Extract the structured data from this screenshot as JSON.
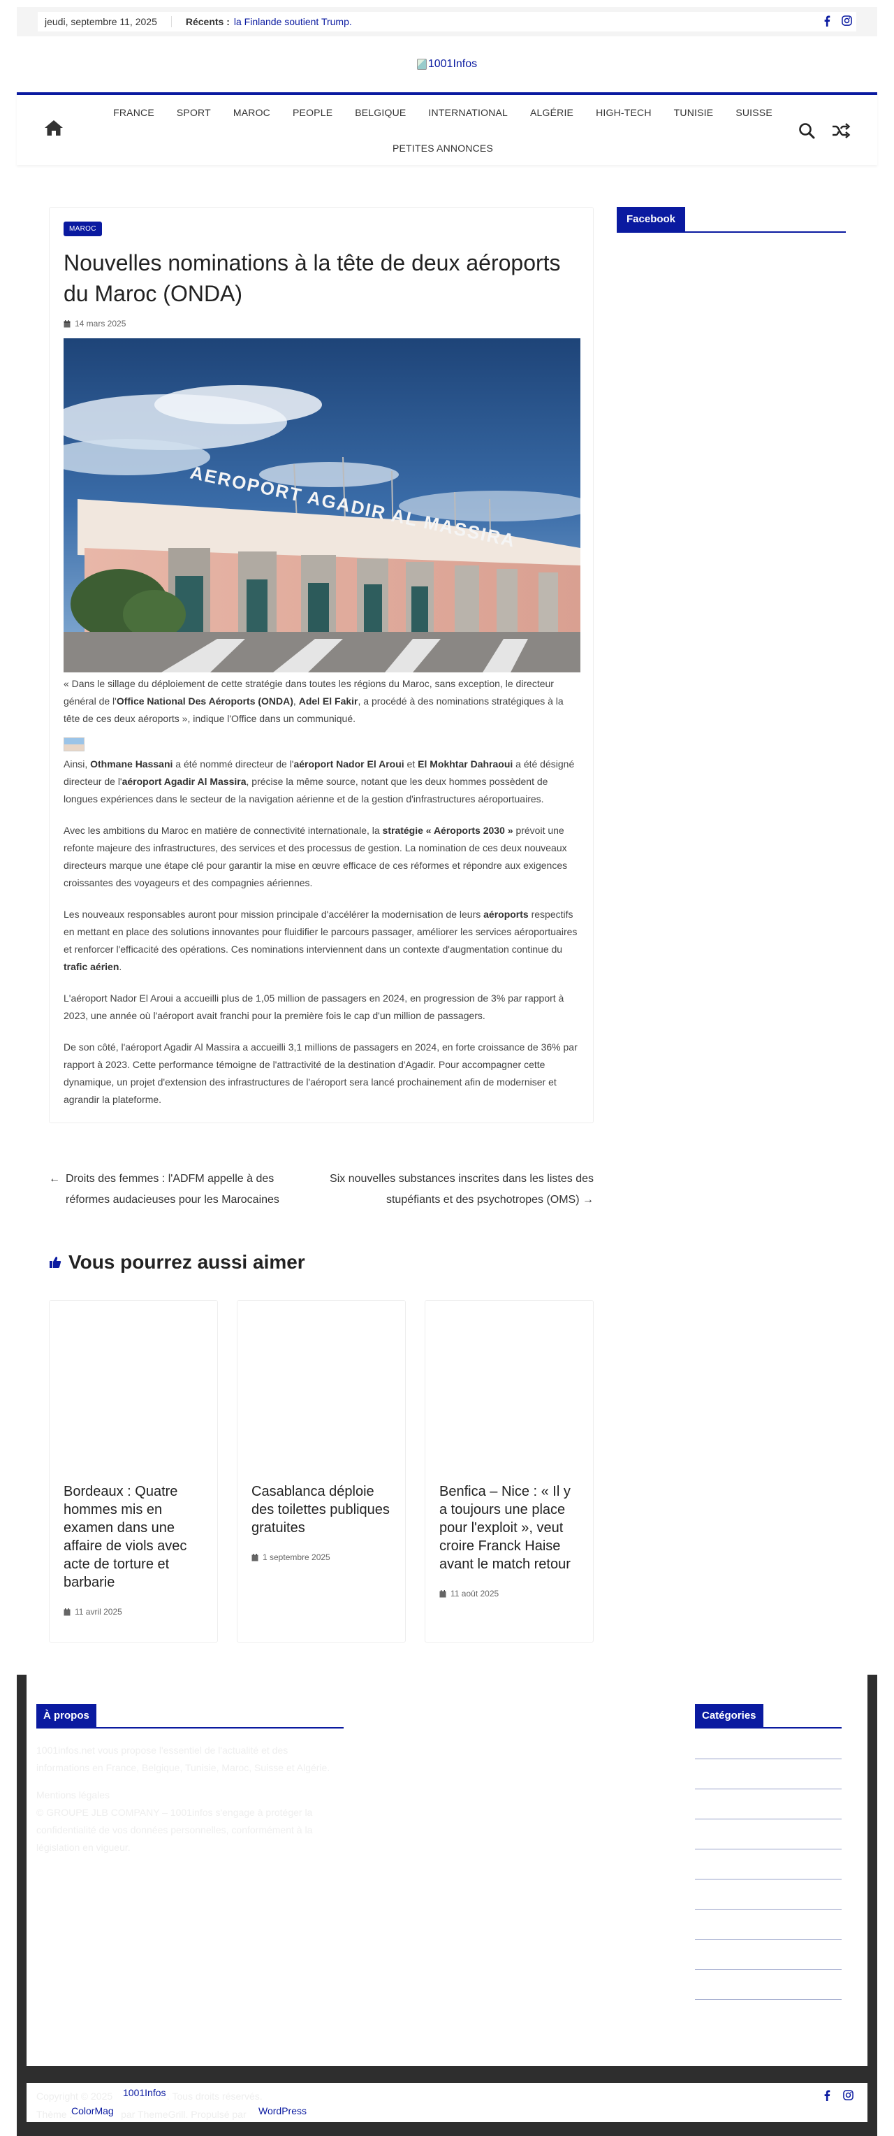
{
  "topbar": {
    "date": "jeudi, septembre 11, 2025",
    "recent_label": "Récents :",
    "recent_link": "la Finlande soutient Trump."
  },
  "site": {
    "logo_alt": "1001Infos"
  },
  "nav": {
    "items": [
      "FRANCE",
      "SPORT",
      "MAROC",
      "PEOPLE",
      "BELGIQUE",
      "INTERNATIONAL",
      "ALGÉRIE",
      "HIGH-TECH",
      "TUNISIE",
      "SUISSE",
      "PETITES ANNONCES"
    ]
  },
  "article": {
    "category": "MAROC",
    "title": "Nouvelles nominations à la tête de deux aéroports du Maroc (ONDA)",
    "date": "14 mars 2025",
    "hero_sign": "AEROPORT AGADIR AL MASSIRA",
    "p1": {
      "a": "« Dans le sillage du déploiement de cette stratégie dans toutes les régions du Maroc, sans exception, le directeur général de l'",
      "b": "Office National Des Aéroports (ONDA)",
      "c": ", ",
      "d": "Adel El Fakir",
      "e": ", a procédé à des nominations stratégiques à la tête de ces deux aéroports », indique l'Office dans un communiqué."
    },
    "p2": {
      "a": "Ainsi, ",
      "b": "Othmane Hassani",
      "c": " a été nommé directeur de l'",
      "d": "aéroport Nador El Aroui",
      "e": " et ",
      "f": "El Mokhtar Dahraoui",
      "g": " a été désigné directeur de l'",
      "h": "aéroport Agadir Al Massira",
      "i": ", précise la même source, notant que les deux hommes possèdent de longues expériences dans le secteur de la navigation aérienne et de la gestion d'infrastructures aéroportuaires."
    },
    "p3": {
      "a": "Avec les ambitions du Maroc en matière de connectivité internationale, la ",
      "b": "stratégie « Aéroports 2030 »",
      "c": " prévoit une refonte majeure des infrastructures, des services et des processus de gestion. La nomination de ces deux nouveaux directeurs marque une étape clé pour garantir la mise en œuvre efficace de ces réformes et répondre aux exigences croissantes des voyageurs et des compagnies aériennes."
    },
    "p4": {
      "a": "Les nouveaux responsables auront pour mission principale d'accélérer la modernisation de leurs ",
      "b": "aéroports",
      "c": " respectifs en mettant en place des solutions innovantes pour fluidifier le parcours passager, améliorer les services aéroportuaires et renforcer l'efficacité des opérations. Ces nominations interviennent dans un contexte d'augmentation continue du ",
      "d": "trafic aérien",
      "e": "."
    },
    "p5": "L'aéroport Nador El Aroui a accueilli plus de 1,05 million de passagers en 2024, en progression de 3% par rapport à 2023, une année où l'aéroport avait franchi pour la première fois le cap d'un million de passagers.",
    "p6": "De son côté, l'aéroport Agadir Al Massira a accueilli 3,1 millions de passagers en 2024, en forte croissance de 36% par rapport à 2023. Cette performance témoigne de l'attractivité de la destination d'Agadir. Pour accompagner cette dynamique, un projet d'extension des infrastructures de l'aéroport sera lancé prochainement afin de moderniser et agrandir la plateforme."
  },
  "sidebar": {
    "facebook_title": "Facebook"
  },
  "postnav": {
    "prev": "Droits des femmes : l'ADFM appelle à des réformes audacieuses pour les Marocaines",
    "next": "Six nouvelles substances inscrites dans les listes des stupéfiants et des psychotropes (OMS)"
  },
  "related": {
    "title": "Vous pourrez aussi aimer",
    "cards": [
      {
        "title": "Bordeaux : Quatre hommes mis en examen dans une affaire de viols avec acte de torture et barbarie",
        "date": "11 avril 2025"
      },
      {
        "title": "Casablanca déploie des toilettes publiques gratuites",
        "date": "1 septembre 2025"
      },
      {
        "title": "Benfica – Nice : « Il y a toujours une place pour l'exploit », veut croire Franck Haise avant le match retour",
        "date": "11 août 2025"
      }
    ]
  },
  "footer": {
    "about_title": "À propos",
    "about_text": "1001infos.net vous propose l'essentiel de l'actualité et des informations en France, Belgique, Tunisie, Maroc, Suisse et Algérie.",
    "legal_title": "Mentions légales",
    "legal_text": "© GROUPE JLB COMPANY – 1001infos s'engage à protéger la confidentialité de vos données personnelles, conformément à la législation en vigueur.",
    "categories_title": "Catégories",
    "copyright_a": "Copyright © 2025",
    "copyright_b": ". Tous droits réservés.",
    "site_link": "1001Infos",
    "theme_text": "Thème :",
    "theme_link": "ColorMag",
    "powered_text": "par ThemeGrill. Propulsé par",
    "wp_link": "WordPress"
  },
  "colors": {
    "accent": "#0a1aa0",
    "footer_dark": "#2e2e2e"
  }
}
